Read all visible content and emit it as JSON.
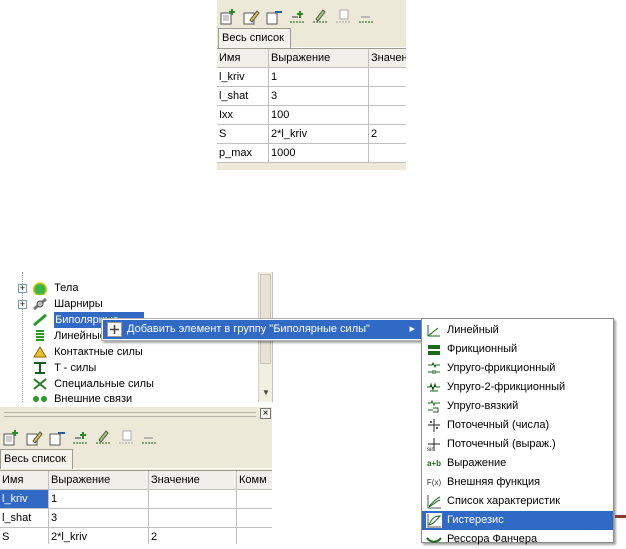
{
  "top_panel": {
    "tab_label": "Весь список",
    "columns": [
      "Имя",
      "Выражение",
      "Значен"
    ],
    "rows": [
      [
        "l_kriv",
        "1",
        ""
      ],
      [
        "l_shat",
        "3",
        ""
      ],
      [
        "Ixx",
        "100",
        ""
      ],
      [
        "S",
        "2*l_kriv",
        "2"
      ],
      [
        "p_max",
        "1000",
        ""
      ]
    ]
  },
  "tree": {
    "items": [
      {
        "label": "Тела",
        "icon": "bodies-icon"
      },
      {
        "label": "Шарниры",
        "icon": "joints-icon"
      },
      {
        "label": "Биполярные",
        "icon": "bipolar-forces-icon"
      },
      {
        "label": "Линейные",
        "icon": "linear-forces-icon"
      },
      {
        "label": "Контактные силы",
        "icon": "contact-forces-icon"
      },
      {
        "label": "T - силы",
        "icon": "t-forces-icon"
      },
      {
        "label": "Специальные силы",
        "icon": "special-forces-icon"
      },
      {
        "label": "Внешние связи",
        "icon": "external-links-icon"
      }
    ]
  },
  "context_menu": {
    "item_label": "Добавить элемент в группу \"Биполярные силы\"",
    "arrow": "▸"
  },
  "submenu": {
    "items": [
      {
        "label": "Линейный",
        "icon": "linear-icon"
      },
      {
        "label": "Фрикционный",
        "icon": "friction-icon"
      },
      {
        "label": "Упруго-фрикционный",
        "icon": "elastic-friction-icon"
      },
      {
        "label": "Упруго-2-фрикционный",
        "icon": "elastic-2-friction-icon"
      },
      {
        "label": "Упруго-вязкий",
        "icon": "viscoelastic-icon"
      },
      {
        "label": "Поточечный (числа)",
        "icon": "pointwise-numbers-icon"
      },
      {
        "label": "Поточечный (выраж.)",
        "icon": "pointwise-expressions-icon"
      },
      {
        "label": "Выражение",
        "icon_text": "a+b",
        "icon": "expression-icon"
      },
      {
        "label": "Внешняя функция",
        "icon_text": "F(x)",
        "icon": "external-function-icon"
      },
      {
        "label": "Список характеристик",
        "icon": "characteristics-list-icon"
      },
      {
        "label": "Гистерезис",
        "icon": "hysteresis-icon",
        "highlighted": true
      },
      {
        "label": "Рессора Фанчера",
        "icon": "fancher-spring-icon"
      }
    ]
  },
  "bottom_panel": {
    "tab_label": "Весь список",
    "close_glyph": "×",
    "columns": [
      "Имя",
      "Выражение",
      "Значение",
      "Комм"
    ],
    "rows": [
      [
        "l_kriv",
        "1",
        "",
        ""
      ],
      [
        "l_shat",
        "3",
        "",
        ""
      ],
      [
        "S",
        "2*l_kriv",
        "2",
        ""
      ]
    ]
  },
  "colors": {
    "toolbar_bg": "#ece9d8",
    "highlight": "#316ac5",
    "grid_line": "#c0c0c0"
  }
}
